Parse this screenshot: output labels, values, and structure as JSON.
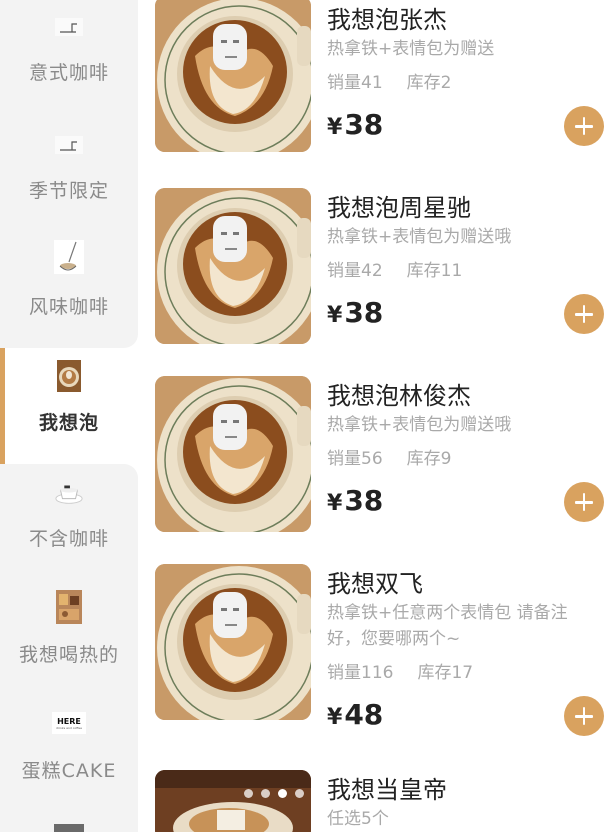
{
  "sidebar": {
    "items": [
      {
        "label": "意式咖啡",
        "icon": "cup-line-icon"
      },
      {
        "label": "季节限定",
        "icon": "cup-line-icon"
      },
      {
        "label": "风味咖啡",
        "icon": "pour-coffee-icon"
      },
      {
        "label": "我想泡",
        "icon": "latte-thumb-icon",
        "active": true
      },
      {
        "label": "不含咖啡",
        "icon": "white-cup-icon"
      },
      {
        "label": "我想喝热的",
        "icon": "hot-drink-thumb-icon"
      },
      {
        "label": "蛋糕CAKE",
        "icon": "here-logo-icon",
        "logo_text": "HERE",
        "logo_sub": "drinks and coffee"
      }
    ]
  },
  "products": [
    {
      "name": "我想泡张杰",
      "desc": "热拿铁+表情包为赠送",
      "sales": "销量41",
      "stock": "库存2",
      "currency": "¥",
      "price": "38"
    },
    {
      "name": "我想泡周星驰",
      "desc": "热拿铁+表情包为赠送哦",
      "sales": "销量42",
      "stock": "库存11",
      "currency": "¥",
      "price": "38"
    },
    {
      "name": "我想泡林俊杰",
      "desc": "热拿铁+表情包为赠送哦",
      "sales": "销量56",
      "stock": "库存9",
      "currency": "¥",
      "price": "38"
    },
    {
      "name": "我想双飞",
      "desc": "热拿铁+任意两个表情包 请备注好，您要哪两个~",
      "sales": "销量116",
      "stock": "库存17",
      "currency": "¥",
      "price": "48"
    },
    {
      "name": "我想当皇帝",
      "desc": "任选5个"
    }
  ],
  "carousel": {
    "active_index": 2,
    "count": 4
  },
  "colors": {
    "accent": "#d9a25f",
    "sidebar_bg": "#f3f3f3",
    "muted_text": "#a9a9a9"
  }
}
